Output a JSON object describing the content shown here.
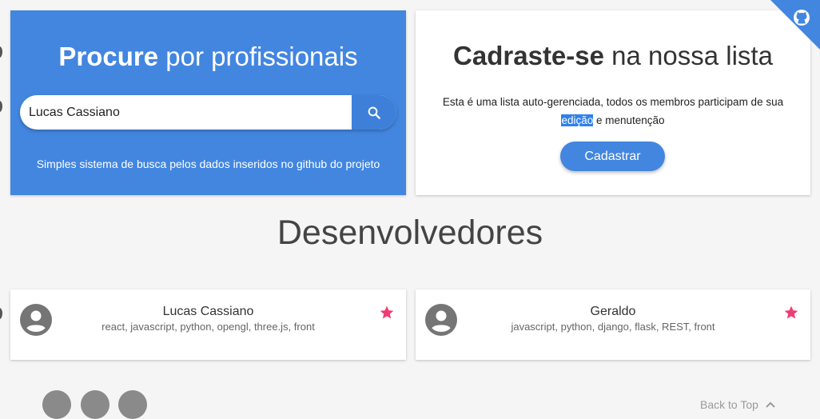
{
  "colors": {
    "primary_blue": "#4286e0",
    "search_button_blue": "#3e80d9",
    "star_pink": "#ef3d74",
    "background": "#f5f5f5",
    "avatar_gray": "#757575"
  },
  "search_panel": {
    "title_bold": "Procure",
    "title_rest": "por profissionais",
    "input_value": "Lucas Cassiano",
    "search_icon": "search-icon",
    "caption": "Simples sistema de busca pelos dados inseridos no github do projeto"
  },
  "register_panel": {
    "title_bold": "Cadraste-se",
    "title_rest": "na nossa lista",
    "description_line1": "Esta é uma lista auto-gerenciada, todos os membros participam de sua",
    "description_highlight": "edição",
    "description_line2_rest": "e menutenção",
    "button_label": "Cadastrar"
  },
  "github_ribbon": {
    "icon": "github-icon"
  },
  "section": {
    "title": "Desenvolvedores"
  },
  "developers": [
    {
      "name": "Lucas Cassiano",
      "skills": "react, javascript, python, opengl, three.js, front",
      "avatar_icon": "account-circle-icon",
      "star_icon": "star-icon"
    },
    {
      "name": "Geraldo",
      "skills": "javascript, python, django, flask, REST, front",
      "avatar_icon": "account-circle-icon",
      "star_icon": "star-icon"
    }
  ],
  "footer": {
    "back_to_top_label": "Back to Top",
    "back_to_top_icon": "chevron-up-icon"
  }
}
